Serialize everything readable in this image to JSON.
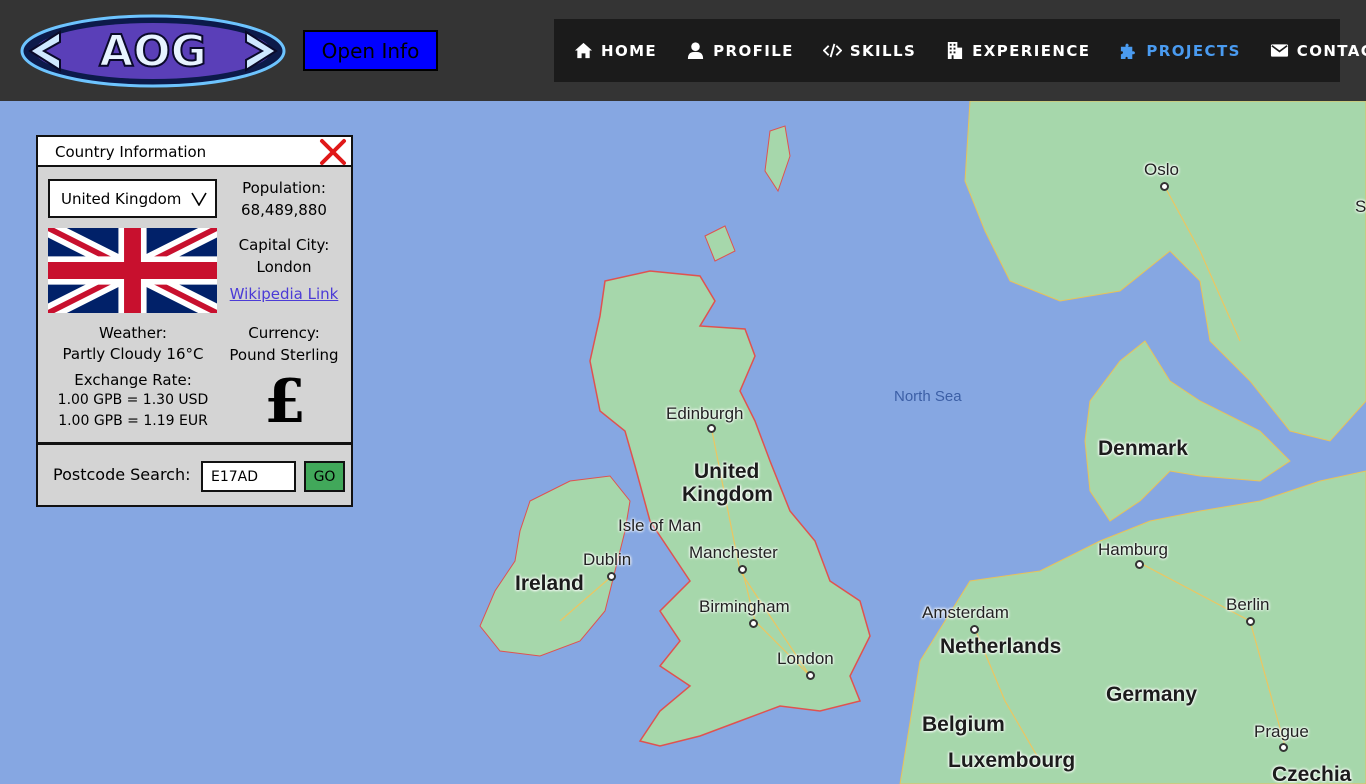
{
  "header": {
    "logo_text": "AOG",
    "open_info_label": "Open Info",
    "nav": [
      {
        "label": "HOME",
        "icon": "home-icon"
      },
      {
        "label": "PROFILE",
        "icon": "user-icon"
      },
      {
        "label": "SKILLS",
        "icon": "code-icon"
      },
      {
        "label": "EXPERIENCE",
        "icon": "building-icon"
      },
      {
        "label": "PROJECTS",
        "icon": "puzzle-icon",
        "active": true
      },
      {
        "label": "CONTACT",
        "icon": "envelope-icon"
      }
    ],
    "active_color": "#4a9bf0"
  },
  "panel": {
    "title": "Country Information",
    "selected_country": "United Kingdom",
    "population_label": "Population:",
    "population_value": "68,489,880",
    "capital_label": "Capital City:",
    "capital_value": "London",
    "wiki_link": "Wikipedia Link",
    "weather_label": "Weather:",
    "weather_value": "Partly Cloudy 16°C",
    "currency_label": "Currency:",
    "currency_value": "Pound Sterling",
    "currency_symbol": "£",
    "exchange_label": "Exchange Rate:",
    "exchange_usd": "1.00 GPB = 1.30 USD",
    "exchange_eur": "1.00 GPB = 1.19 EUR",
    "postcode_label": "Postcode Search:",
    "postcode_value": "E17AD",
    "go_label": "GO"
  },
  "map": {
    "labels": {
      "oslo": "Oslo",
      "s_partial": "S",
      "north_sea": "North Sea",
      "denmark": "Denmark",
      "edinburgh": "Edinburgh",
      "uk_line1": "United",
      "uk_line2": "Kingdom",
      "isle_of_man": "Isle of Man",
      "dublin": "Dublin",
      "ireland": "Ireland",
      "manchester": "Manchester",
      "birmingham": "Birmingham",
      "london": "London",
      "hamburg": "Hamburg",
      "amsterdam": "Amsterdam",
      "netherlands": "Netherlands",
      "berlin": "Berlin",
      "germany": "Germany",
      "belgium": "Belgium",
      "luxembourg": "Luxembourg",
      "prague": "Prague",
      "czechia": "Czechia"
    },
    "colors": {
      "sea": "#86a7e2",
      "land": "#9fd4a8",
      "uk_border": "#e0524f"
    }
  }
}
